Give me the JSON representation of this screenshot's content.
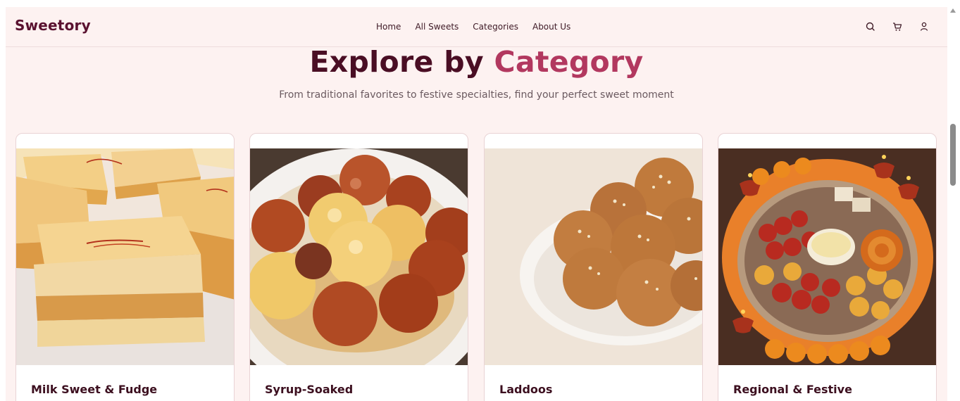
{
  "header": {
    "brand": "Sweetory",
    "nav": [
      "Home",
      "All Sweets",
      "Categories",
      "About Us"
    ],
    "icons": [
      "search-icon",
      "cart-icon",
      "user-icon"
    ]
  },
  "hero": {
    "title_main": "Explore by",
    "title_accent": "Category",
    "subtitle": "From traditional favorites to festive specialties, find your perfect sweet moment"
  },
  "categories": [
    {
      "label": "Milk Sweet & Fudge"
    },
    {
      "label": "Syrup-Soaked"
    },
    {
      "label": "Laddoos"
    },
    {
      "label": "Regional & Festive"
    }
  ],
  "colors": {
    "page_bg": "#fdf2f1",
    "brand": "#5a1230",
    "title": "#4a0e24",
    "accent": "#b2385f"
  }
}
